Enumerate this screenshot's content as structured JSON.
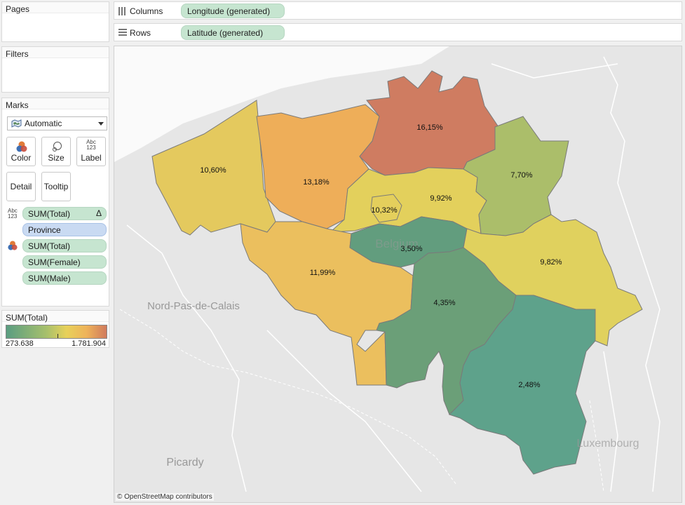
{
  "left_panel": {
    "pages": {
      "title": "Pages"
    },
    "filters": {
      "title": "Filters"
    },
    "marks": {
      "title": "Marks",
      "mark_type": "Automatic",
      "buttons": {
        "color": "Color",
        "size": "Size",
        "label": "Label",
        "detail": "Detail",
        "tooltip": "Tooltip"
      },
      "abc_glyph": "Abc",
      "num_glyph": "123",
      "fields": [
        {
          "label": "SUM(Total)",
          "badge": "Δ"
        },
        {
          "label": "Province"
        },
        {
          "label": "SUM(Total)"
        },
        {
          "label": "SUM(Female)"
        },
        {
          "label": "SUM(Male)"
        }
      ]
    },
    "legend": {
      "title": "SUM(Total)",
      "min": "273.638",
      "max": "1.781.904"
    }
  },
  "shelves": {
    "columns": {
      "label": "Columns",
      "pill": "Longitude (generated)"
    },
    "rows": {
      "label": "Rows",
      "pill": "Latitude (generated)"
    }
  },
  "map": {
    "attribution": "© OpenStreetMap contributors",
    "places": {
      "nord": "Nord-Pas-de-Calais",
      "picardy": "Picardy",
      "luxembourg": "Luxembourg",
      "belgium": "Belgium"
    },
    "provinces": [
      {
        "id": "west-flanders",
        "label": "10,60%",
        "color": "#e4c95e"
      },
      {
        "id": "east-flanders",
        "label": "13,18%",
        "color": "#eeae59"
      },
      {
        "id": "antwerp",
        "label": "16,15%",
        "color": "#cf7c61"
      },
      {
        "id": "flemish-brabant",
        "label": "9,92%",
        "color": "#e3d05c"
      },
      {
        "id": "brussels",
        "label": "10,32%",
        "color": "#e4cf5c"
      },
      {
        "id": "limburg",
        "label": "7,70%",
        "color": "#abbe6a"
      },
      {
        "id": "hainaut",
        "label": "11,99%",
        "color": "#ebbf5e"
      },
      {
        "id": "walloon-brabant",
        "label": "3,50%",
        "color": "#629d7e"
      },
      {
        "id": "liege",
        "label": "9,82%",
        "color": "#e0d15e"
      },
      {
        "id": "namur",
        "label": "4,35%",
        "color": "#6b9f78"
      },
      {
        "id": "luxembourg-prov",
        "label": "2,48%",
        "color": "#5ea28b"
      }
    ]
  }
}
